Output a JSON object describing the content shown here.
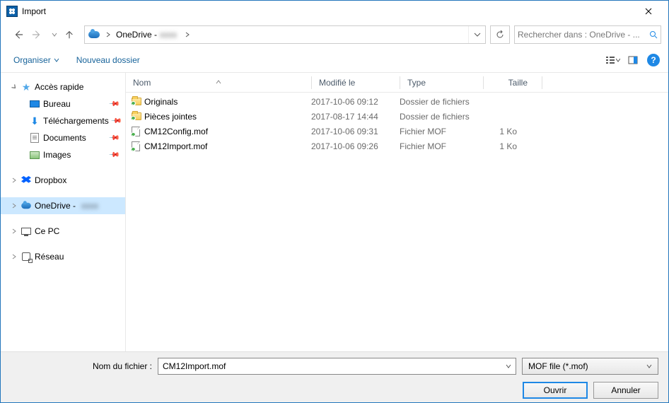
{
  "title": "Import",
  "breadcrumb": {
    "root": "OneDrive -"
  },
  "search": {
    "placeholder": "Rechercher dans : OneDrive - ..."
  },
  "toolbar": {
    "organize": "Organiser",
    "newfolder": "Nouveau dossier"
  },
  "columns": {
    "name": "Nom",
    "modified": "Modifié le",
    "type": "Type",
    "size": "Taille"
  },
  "sidebar": {
    "quick": "Accès rapide",
    "desktop": "Bureau",
    "downloads": "Téléchargements",
    "documents": "Documents",
    "images": "Images",
    "dropbox": "Dropbox",
    "onedrive": "OneDrive -",
    "pc": "Ce PC",
    "network": "Réseau"
  },
  "files": [
    {
      "name": "Originals",
      "modified": "2017-10-06 09:12",
      "type": "Dossier de fichiers",
      "size": "",
      "kind": "folder"
    },
    {
      "name": "Pièces jointes",
      "modified": "2017-08-17 14:44",
      "type": "Dossier de fichiers",
      "size": "",
      "kind": "folder"
    },
    {
      "name": "CM12Config.mof",
      "modified": "2017-10-06 09:31",
      "type": "Fichier MOF",
      "size": "1 Ko",
      "kind": "file"
    },
    {
      "name": "CM12Import.mof",
      "modified": "2017-10-06 09:26",
      "type": "Fichier MOF",
      "size": "1 Ko",
      "kind": "file"
    }
  ],
  "bottom": {
    "label": "Nom du fichier :",
    "value": "CM12Import.mof",
    "filter": "MOF file (*.mof)",
    "open": "Ouvrir",
    "cancel": "Annuler"
  }
}
